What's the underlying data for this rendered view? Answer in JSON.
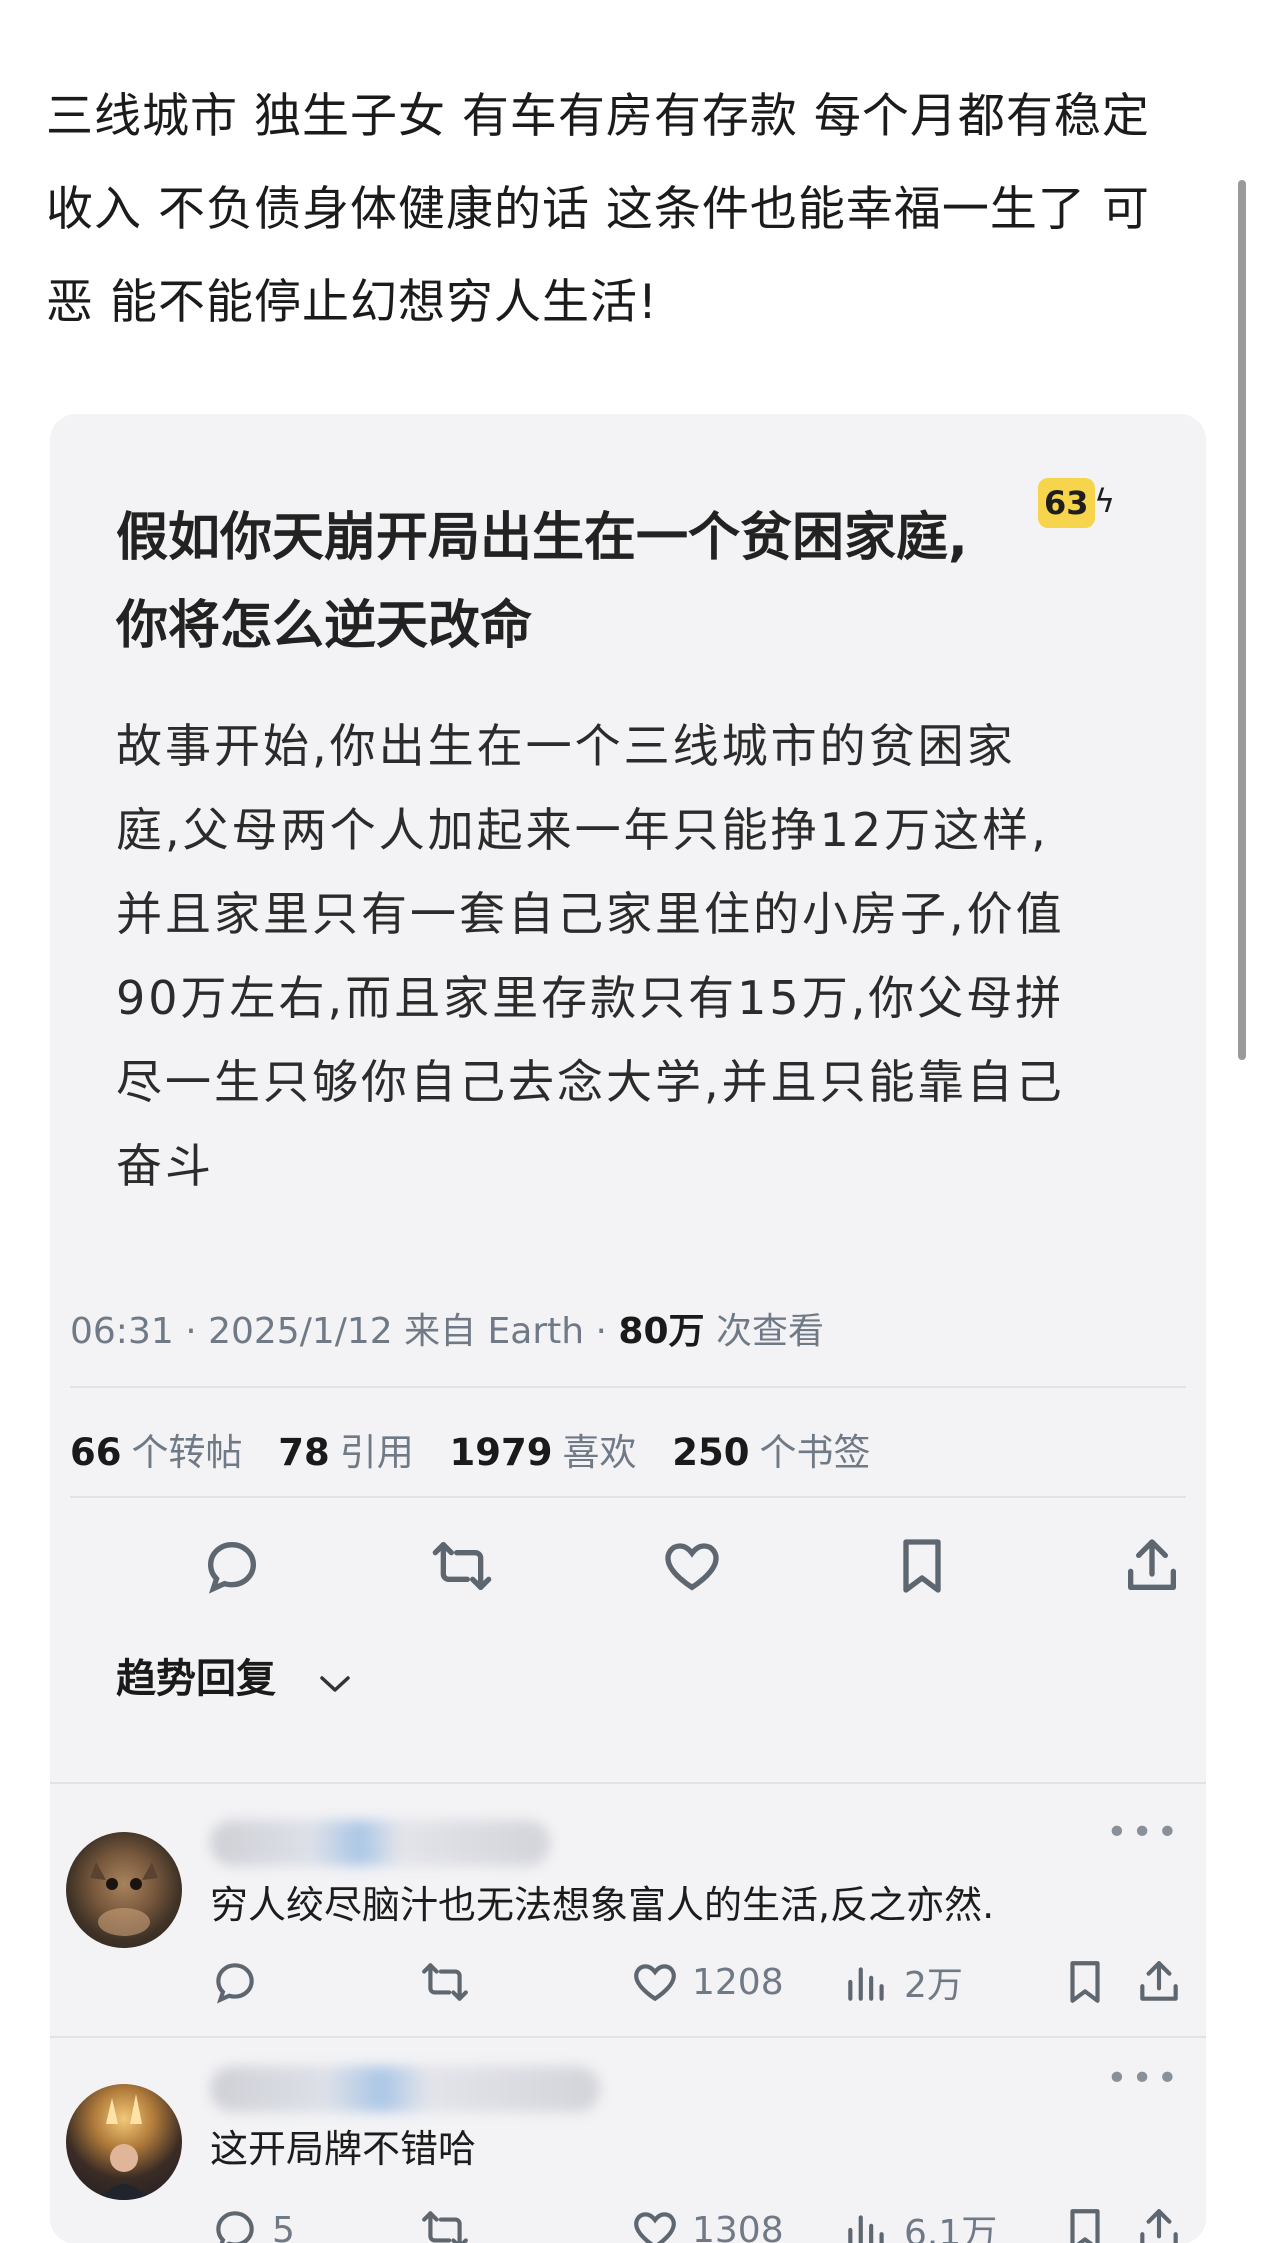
{
  "caption": {
    "line1": "三线城市 独生子女 有车有房有存款 每个月都有稳定",
    "line2": "收入 不负债身体健康的话 这条件也能幸福一生了 可",
    "line3": "恶 能不能停止幻想穷人生活!"
  },
  "post": {
    "headline_line1": "假如你天崩开局出生在一个贫困家庭,",
    "headline_line2": "你将怎么逆天改命",
    "badge": "63",
    "story": [
      "故事开始,你出生在一个三线城市的贫困家",
      "庭,父母两个人加起来一年只能挣12万这样,",
      "并且家里只有一套自己家里住的小房子,价值",
      "90万左右,而且家里存款只有15万,你父母拼",
      "尽一生只够你自己去念大学,并且只能靠自己",
      "奋斗"
    ],
    "meta_time": "06:31 · 2025/1/12 来自 Earth · ",
    "meta_views": "80万",
    "meta_views_label": " 次查看",
    "stats": {
      "reposts": "66",
      "reposts_label": "个转帖",
      "quotes": "78",
      "quotes_label": "引用",
      "likes": "1979",
      "likes_label": "喜欢",
      "bookmarks": "250",
      "bookmarks_label": "个书签"
    }
  },
  "replies_header": "趋势回复",
  "replies": [
    {
      "text": "穷人绞尽脑汁也无法想象富人的生活,反之亦然.",
      "comments": "",
      "likes": "1208",
      "views": "2万"
    },
    {
      "text": "这开局牌不错哈",
      "comments": "5",
      "likes": "1308",
      "views": "6.1万"
    }
  ],
  "icons": [
    "reply-icon",
    "repost-icon",
    "like-icon",
    "bookmark-icon",
    "share-icon",
    "views-icon",
    "more-icon",
    "chevron-down-icon",
    "bolt-icon"
  ],
  "colors": {
    "badge": "#f6d44b",
    "card": "#f3f3f5",
    "muted": "#707a86"
  }
}
